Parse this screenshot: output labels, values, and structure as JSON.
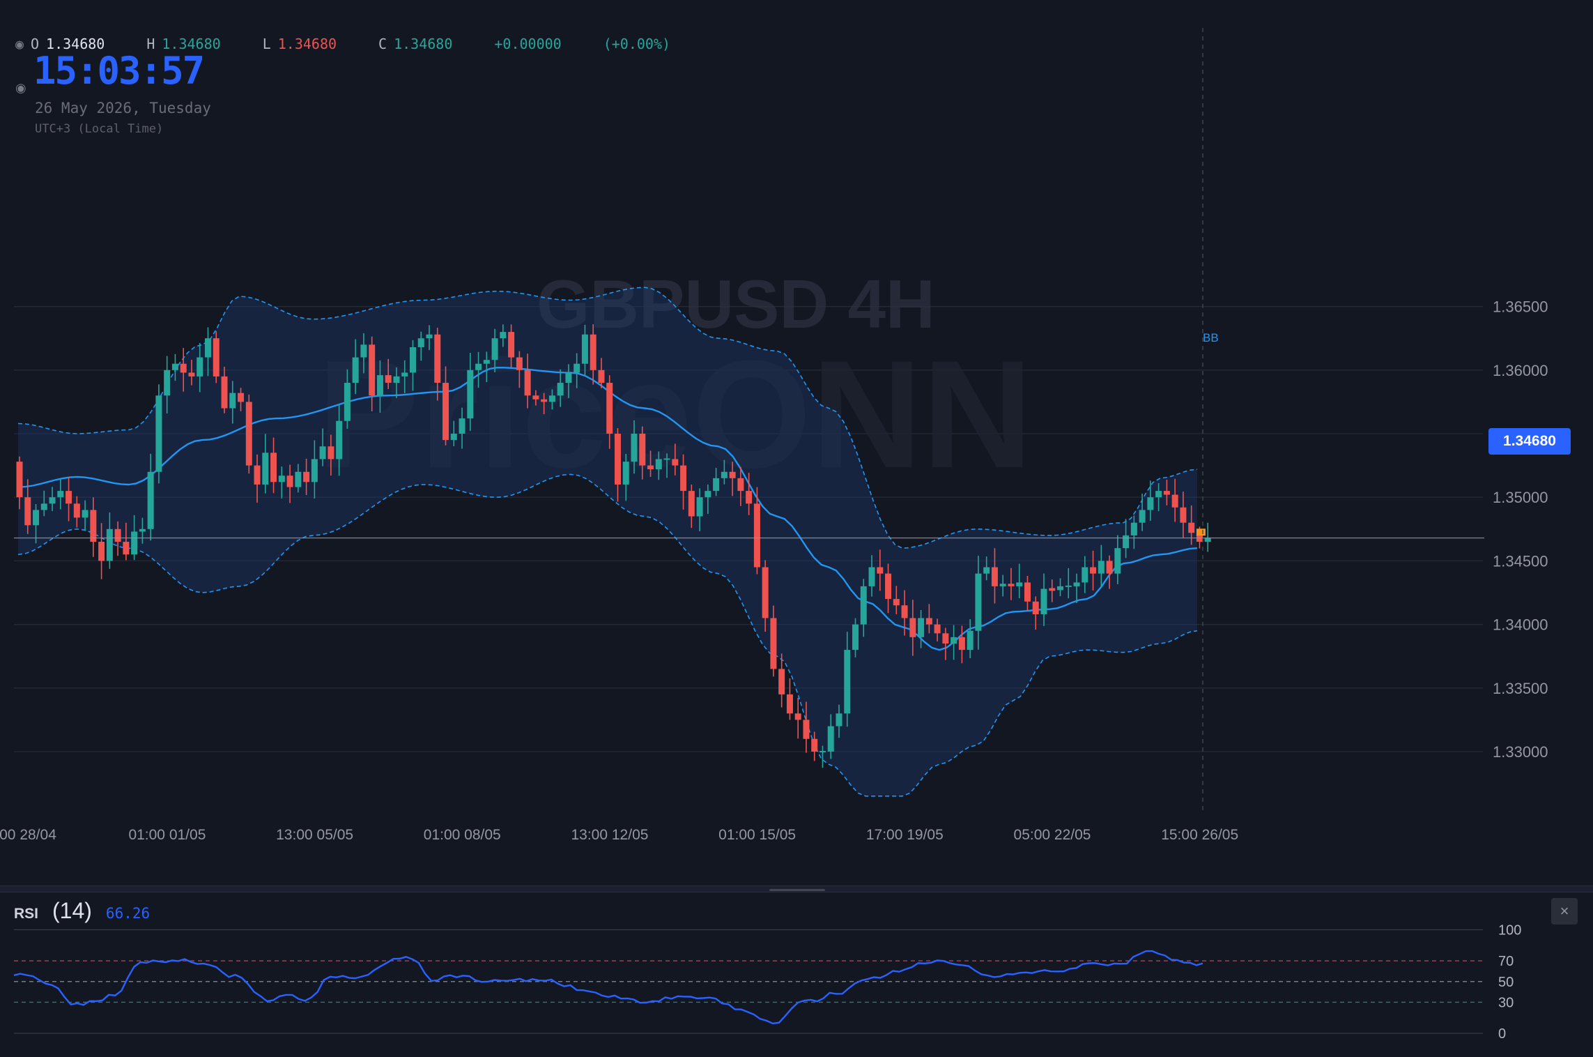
{
  "colors": {
    "background": "#131722",
    "up": "#26a69a",
    "down": "#ef5350",
    "bb_mid": "#2196f3",
    "bb_band": "#2962ff",
    "rsi_line": "#2962ff",
    "accent": "#2962ff",
    "last_candle": "#f7931a"
  },
  "icons": {
    "legend_eye": "eye-icon",
    "close": "close-icon"
  },
  "legend": {
    "open_key": "O",
    "open": "1.34680",
    "high_key": "H",
    "high": "1.34680",
    "low_key": "L",
    "low": "1.34680",
    "close_key": "C",
    "close": "1.34680",
    "change": "+0.00000",
    "change_pct": "(+0.00%)"
  },
  "clock": {
    "time": "15:03:57",
    "date": "26 May 2026, Tuesday",
    "timezone": "UTC+3 (Local Time)"
  },
  "watermark": {
    "symbol": "GBPUSD 4H",
    "brand": "PriceONN"
  },
  "indicator_label": "BB",
  "current_price": "1.34680",
  "rsi": {
    "name": "RSI",
    "period": "(14)",
    "value": "66.26",
    "close_symbol": "×"
  },
  "chart_data": [
    {
      "type": "candlestick",
      "symbol": "GBPUSD",
      "timeframe": "4H",
      "y_ticks": [
        1.33,
        1.335,
        1.34,
        1.345,
        1.35,
        1.355,
        1.36,
        1.365
      ],
      "y_tick_labels": [
        "1.33000",
        "1.33500",
        "1.34000",
        "1.34500",
        "1.35000",
        "1.35500",
        "1.36000",
        "1.36500"
      ],
      "ylim": [
        1.3265,
        1.3684
      ],
      "x_tick_labels": [
        "00 28/04",
        "01:00 01/05",
        "13:00 05/05",
        "01:00 08/05",
        "13:00 12/05",
        "01:00 15/05",
        "17:00 19/05",
        "05:00 22/05",
        "15:00 26/05"
      ],
      "x_tick_positions": [
        0,
        17,
        35,
        53,
        71,
        89,
        107,
        125,
        143
      ],
      "last_price": 1.3468,
      "closes": [
        1.35,
        1.3478,
        1.349,
        1.3495,
        1.35,
        1.3505,
        1.3495,
        1.3484,
        1.349,
        1.3465,
        1.345,
        1.3475,
        1.3465,
        1.3455,
        1.3473,
        1.3475,
        1.352,
        1.358,
        1.36,
        1.3605,
        1.3598,
        1.3595,
        1.361,
        1.3625,
        1.3595,
        1.357,
        1.3582,
        1.3575,
        1.3525,
        1.351,
        1.3535,
        1.3512,
        1.3517,
        1.3508,
        1.352,
        1.3512,
        1.353,
        1.354,
        1.353,
        1.356,
        1.359,
        1.361,
        1.362,
        1.358,
        1.3596,
        1.359,
        1.3595,
        1.3598,
        1.3618,
        1.3625,
        1.3628,
        1.359,
        1.3545,
        1.355,
        1.3562,
        1.36,
        1.3605,
        1.3608,
        1.3625,
        1.363,
        1.361,
        1.36,
        1.358,
        1.3577,
        1.3575,
        1.358,
        1.359,
        1.3598,
        1.3605,
        1.3628,
        1.36,
        1.359,
        1.355,
        1.351,
        1.3528,
        1.355,
        1.3525,
        1.3522,
        1.353,
        1.353,
        1.3525,
        1.3505,
        1.3485,
        1.35,
        1.3505,
        1.3515,
        1.352,
        1.3515,
        1.3505,
        1.3495,
        1.3445,
        1.3405,
        1.3365,
        1.3345,
        1.333,
        1.3325,
        1.331,
        1.33,
        1.33,
        1.332,
        1.333,
        1.338,
        1.34,
        1.343,
        1.3445,
        1.344,
        1.342,
        1.3415,
        1.3405,
        1.339,
        1.3405,
        1.34,
        1.3393,
        1.3385,
        1.339,
        1.338,
        1.3395,
        1.344,
        1.3445,
        1.343,
        1.3432,
        1.343,
        1.3433,
        1.3418,
        1.3408,
        1.3428,
        1.3427,
        1.343,
        1.343,
        1.3433,
        1.3445,
        1.344,
        1.345,
        1.344,
        1.346,
        1.347,
        1.348,
        1.349,
        1.35,
        1.3505,
        1.3502,
        1.3492,
        1.348,
        1.3472,
        1.3465,
        1.3468
      ],
      "bollinger_bands": {
        "period_hint": "BB",
        "mid_keypoints": [
          [
            0,
            1.3508
          ],
          [
            8,
            1.3516
          ],
          [
            15,
            1.351
          ],
          [
            25,
            1.3545
          ],
          [
            35,
            1.3562
          ],
          [
            50,
            1.358
          ],
          [
            58,
            1.3583
          ],
          [
            65,
            1.3602
          ],
          [
            75,
            1.3598
          ],
          [
            85,
            1.357
          ],
          [
            95,
            1.354
          ],
          [
            103,
            1.3485
          ],
          [
            110,
            1.3445
          ],
          [
            115,
            1.3418
          ],
          [
            120,
            1.3398
          ],
          [
            125,
            1.338
          ],
          [
            130,
            1.3398
          ],
          [
            135,
            1.341
          ],
          [
            140,
            1.3412
          ],
          [
            145,
            1.342
          ],
          [
            150,
            1.3448
          ],
          [
            155,
            1.3455
          ],
          [
            160,
            1.346
          ]
        ],
        "upper_keypoints": [
          [
            0,
            1.3558
          ],
          [
            8,
            1.355
          ],
          [
            15,
            1.3553
          ],
          [
            25,
            1.362
          ],
          [
            30,
            1.3658
          ],
          [
            40,
            1.364
          ],
          [
            55,
            1.3655
          ],
          [
            65,
            1.3662
          ],
          [
            75,
            1.3655
          ],
          [
            85,
            1.3665
          ],
          [
            95,
            1.3625
          ],
          [
            103,
            1.3615
          ],
          [
            110,
            1.357
          ],
          [
            120,
            1.346
          ],
          [
            130,
            1.3475
          ],
          [
            140,
            1.347
          ],
          [
            150,
            1.348
          ],
          [
            155,
            1.3515
          ],
          [
            160,
            1.3522
          ]
        ],
        "lower_keypoints": [
          [
            0,
            1.3455
          ],
          [
            8,
            1.3475
          ],
          [
            15,
            1.346
          ],
          [
            25,
            1.3425
          ],
          [
            30,
            1.343
          ],
          [
            40,
            1.347
          ],
          [
            55,
            1.351
          ],
          [
            65,
            1.35
          ],
          [
            75,
            1.3518
          ],
          [
            85,
            1.3485
          ],
          [
            95,
            1.344
          ],
          [
            103,
            1.3375
          ],
          [
            110,
            1.329
          ],
          [
            115,
            1.3265
          ],
          [
            120,
            1.3265
          ],
          [
            125,
            1.329
          ],
          [
            130,
            1.3305
          ],
          [
            135,
            1.334
          ],
          [
            140,
            1.3375
          ],
          [
            145,
            1.338
          ],
          [
            150,
            1.3378
          ],
          [
            155,
            1.3385
          ],
          [
            160,
            1.3395
          ]
        ]
      }
    },
    {
      "type": "line",
      "title": "RSI (14)",
      "ylim": [
        0,
        100
      ],
      "y_ticks": [
        0,
        30,
        50,
        70,
        100
      ],
      "y_tick_labels": [
        "0",
        "30",
        "50",
        "70",
        "100"
      ],
      "reference_lines": [
        30,
        50,
        70
      ],
      "value_label": "66.26",
      "keypoints": [
        [
          0,
          58
        ],
        [
          3,
          55
        ],
        [
          6,
          46
        ],
        [
          10,
          27
        ],
        [
          13,
          30
        ],
        [
          16,
          38
        ],
        [
          20,
          70
        ],
        [
          25,
          70
        ],
        [
          27,
          72
        ],
        [
          30,
          66
        ],
        [
          35,
          55
        ],
        [
          40,
          32
        ],
        [
          43,
          38
        ],
        [
          46,
          30
        ],
        [
          50,
          53
        ],
        [
          55,
          55
        ],
        [
          60,
          70
        ],
        [
          63,
          73
        ],
        [
          66,
          52
        ],
        [
          70,
          55
        ],
        [
          75,
          50
        ],
        [
          80,
          52
        ],
        [
          85,
          50
        ],
        [
          90,
          42
        ],
        [
          95,
          35
        ],
        [
          100,
          31
        ],
        [
          105,
          34
        ],
        [
          110,
          33
        ],
        [
          115,
          23
        ],
        [
          120,
          10
        ],
        [
          125,
          30
        ],
        [
          130,
          38
        ],
        [
          135,
          52
        ],
        [
          140,
          60
        ],
        [
          145,
          70
        ],
        [
          150,
          65
        ],
        [
          155,
          55
        ],
        [
          160,
          58
        ],
        [
          165,
          60
        ],
        [
          170,
          66
        ],
        [
          175,
          68
        ],
        [
          180,
          80
        ],
        [
          185,
          68
        ],
        [
          188,
          66
        ]
      ]
    }
  ]
}
